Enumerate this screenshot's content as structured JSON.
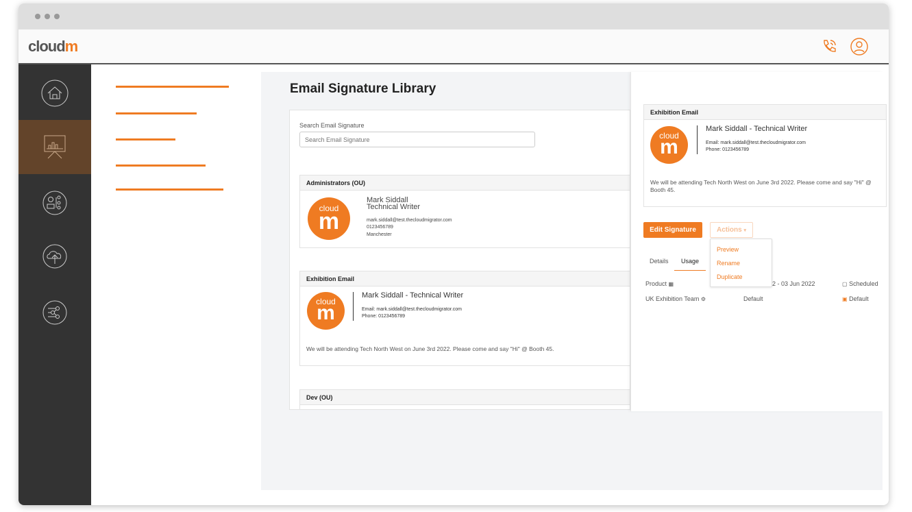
{
  "brand": {
    "logo_main": "cloud",
    "logo_accent": "m",
    "accent": "#ef7b22"
  },
  "header": {
    "icons": [
      "phone-icon",
      "user-icon"
    ]
  },
  "sidebar": {
    "items": [
      {
        "icon": "home-icon"
      },
      {
        "icon": "presentation-chart-icon",
        "active": true
      },
      {
        "icon": "users-network-icon"
      },
      {
        "icon": "cloud-upload-icon"
      },
      {
        "icon": "share-nodes-icon"
      }
    ]
  },
  "page": {
    "title": "Email Signature Library"
  },
  "search": {
    "label": "Search Email Signature",
    "placeholder": "Search Email Signature"
  },
  "signatures": [
    {
      "group": "Administrators (OU)",
      "name": "Mark Siddall",
      "role": "Technical Writer",
      "email": "mark.siddall@test.thecloudmigrator.com",
      "phone": "0123456789",
      "city": "Manchester"
    },
    {
      "group": "Exhibition Email",
      "title_line": "Mark Siddall - Technical Writer",
      "email": "Email: mark.siddall@test.thecloudmigrator.com",
      "phone": "Phone: 0123456789",
      "note": "We will be attending Tech North West on June 3rd 2022. Please come and say \"Hi\" @ Booth 45."
    },
    {
      "group": "Dev (OU)"
    }
  ],
  "avatar": {
    "line1": "cloud",
    "line2": "m"
  },
  "panel": {
    "preview": {
      "title": "Exhibition Email",
      "title_line": "Mark Siddall - Technical Writer",
      "email": "Email: mark.siddall@test.thecloudmigrator.com",
      "phone": "Phone: 0123456789",
      "note": "We will be attending Tech North West on June 3rd 2022. Please come and say \"Hi\" @ Booth 45."
    },
    "edit_label": "Edit Signature",
    "actions_label": "Actions",
    "actions_menu": [
      "Preview",
      "Rename",
      "Duplicate"
    ],
    "tabs": [
      {
        "label": "Details"
      },
      {
        "label": "Usage",
        "active": true
      }
    ],
    "usage": [
      {
        "name": "Product",
        "range": "022 - 03 Jun 2022",
        "status": "Scheduled"
      },
      {
        "name": "UK Exhibition Team",
        "range": "Default",
        "status": "Default"
      }
    ]
  }
}
